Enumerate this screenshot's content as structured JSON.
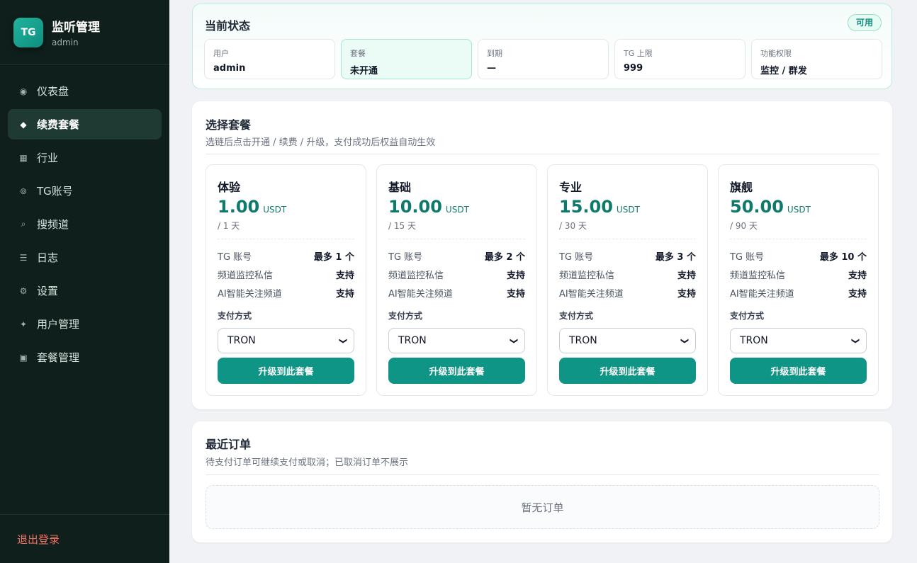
{
  "sidebar": {
    "logo_text": "TG",
    "title": "监听管理",
    "subtitle": "admin",
    "items": [
      {
        "label": "仪表盘",
        "icon": "◉",
        "icon_name": "dashboard-icon"
      },
      {
        "label": "续费套餐",
        "icon": "◆",
        "icon_name": "diamond-icon",
        "active": true
      },
      {
        "label": "行业",
        "icon": "▦",
        "icon_name": "grid-icon"
      },
      {
        "label": "TG账号",
        "icon": "⊚",
        "icon_name": "account-icon"
      },
      {
        "label": "搜频道",
        "icon": "⌕",
        "icon_name": "search-icon"
      },
      {
        "label": "日志",
        "icon": "☰",
        "icon_name": "list-icon"
      },
      {
        "label": "设置",
        "icon": "⚙",
        "icon_name": "gear-icon"
      },
      {
        "label": "用户管理",
        "icon": "✦",
        "icon_name": "sparkle-icon"
      },
      {
        "label": "套餐管理",
        "icon": "▣",
        "icon_name": "package-icon"
      }
    ],
    "logout": "退出登录"
  },
  "status": {
    "title": "当前状态",
    "badge": "可用",
    "fields": [
      {
        "label": "用户",
        "value": "admin"
      },
      {
        "label": "套餐",
        "value": "未开通",
        "highlight": true
      },
      {
        "label": "到期",
        "value": "—"
      },
      {
        "label": "TG 上限",
        "value": "999"
      },
      {
        "label": "功能权限",
        "value": "监控 / 群发"
      }
    ]
  },
  "plans_section": {
    "title": "选择套餐",
    "subtitle": "选链后点击开通 / 续费 / 升级，支付成功后权益自动生效",
    "pay_label": "支付方式",
    "plans": [
      {
        "name": "体验",
        "price": "1.00",
        "unit": "USDT",
        "period": "/ 1 天",
        "features": [
          {
            "label": "TG 账号",
            "value": "最多 1 个"
          },
          {
            "label": "频道监控私信",
            "value": "支持"
          },
          {
            "label": "AI智能关注频道",
            "value": "支持"
          }
        ],
        "payment": "TRON",
        "button": "升级到此套餐"
      },
      {
        "name": "基础",
        "price": "10.00",
        "unit": "USDT",
        "period": "/ 15 天",
        "features": [
          {
            "label": "TG 账号",
            "value": "最多 2 个"
          },
          {
            "label": "频道监控私信",
            "value": "支持"
          },
          {
            "label": "AI智能关注频道",
            "value": "支持"
          }
        ],
        "payment": "TRON",
        "button": "升级到此套餐"
      },
      {
        "name": "专业",
        "price": "15.00",
        "unit": "USDT",
        "period": "/ 30 天",
        "features": [
          {
            "label": "TG 账号",
            "value": "最多 3 个"
          },
          {
            "label": "频道监控私信",
            "value": "支持"
          },
          {
            "label": "AI智能关注频道",
            "value": "支持"
          }
        ],
        "payment": "TRON",
        "button": "升级到此套餐"
      },
      {
        "name": "旗舰",
        "price": "50.00",
        "unit": "USDT",
        "period": "/ 90 天",
        "features": [
          {
            "label": "TG 账号",
            "value": "最多 10 个"
          },
          {
            "label": "频道监控私信",
            "value": "支持"
          },
          {
            "label": "AI智能关注频道",
            "value": "支持"
          }
        ],
        "payment": "TRON",
        "button": "升级到此套餐"
      }
    ]
  },
  "orders": {
    "title": "最近订单",
    "subtitle": "待支付订单可继续支付或取消；已取消订单不展示",
    "empty": "暂无订单"
  },
  "colors": {
    "sidebar_bg": "#0f1f1b",
    "accent": "#0f9585",
    "price": "#0f7a6c",
    "logout": "#f47164"
  }
}
